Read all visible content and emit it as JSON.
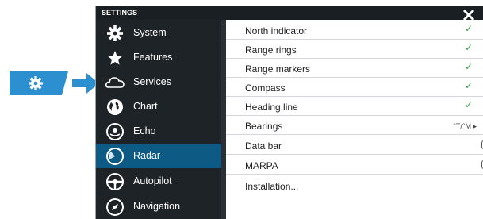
{
  "window": {
    "title": "SETTINGS"
  },
  "sidebar": {
    "items": [
      {
        "label": "System",
        "icon": "gear-icon",
        "selected": false
      },
      {
        "label": "Features",
        "icon": "star-icon",
        "selected": false
      },
      {
        "label": "Services",
        "icon": "cloud-icon",
        "selected": false
      },
      {
        "label": "Chart",
        "icon": "globe-icon",
        "selected": false
      },
      {
        "label": "Echo",
        "icon": "fish-echo-icon",
        "selected": false
      },
      {
        "label": "Radar",
        "icon": "radar-icon",
        "selected": true
      },
      {
        "label": "Autopilot",
        "icon": "steering-wheel-icon",
        "selected": false
      },
      {
        "label": "Navigation",
        "icon": "compass-icon",
        "selected": false
      }
    ]
  },
  "settings": {
    "rows": [
      {
        "label": "North indicator",
        "checked": true
      },
      {
        "label": "Range rings",
        "checked": true
      },
      {
        "label": "Range markers",
        "checked": true
      },
      {
        "label": "Compass",
        "checked": true
      },
      {
        "label": "Heading line",
        "checked": true
      },
      {
        "label": "Bearings",
        "value": "°T/°M ▸"
      },
      {
        "label": "Data bar",
        "value": ""
      },
      {
        "label": "MARPA",
        "value": ""
      },
      {
        "label": "Installation..."
      }
    ],
    "check_glyph": "✓"
  },
  "colors": {
    "accent": "#2c8fd0",
    "selected": "#0d5a85",
    "sidebar_bg": "#1e2328",
    "check": "#3aa648"
  }
}
